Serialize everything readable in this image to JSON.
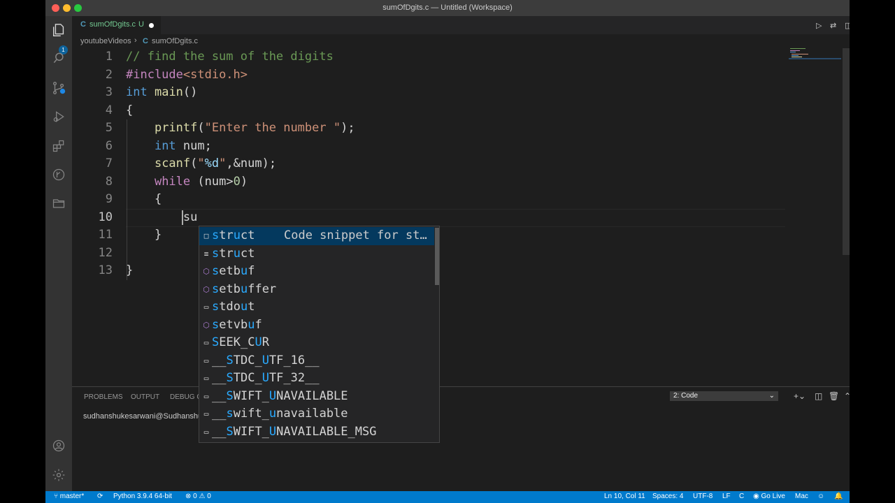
{
  "window": {
    "title": "sumOfDgits.c — Untitled (Workspace)"
  },
  "activity_bar": {
    "explorer_badge": "1"
  },
  "tab": {
    "icon": "C",
    "filename": "sumOfDgits.c",
    "status": "U"
  },
  "breadcrumb": {
    "folder": "youtubeVideos",
    "sep": "›",
    "file_icon": "C",
    "file": "sumOfDgits.c"
  },
  "editor": {
    "lines": [
      {
        "n": "1",
        "text": "// find the sum of the digits"
      },
      {
        "n": "2",
        "text": "#include<stdio.h>"
      },
      {
        "n": "3",
        "text": "int main()"
      },
      {
        "n": "4",
        "text": "{"
      },
      {
        "n": "5",
        "text": "    printf(\"Enter the number \");"
      },
      {
        "n": "6",
        "text": "    int num;"
      },
      {
        "n": "7",
        "text": "    scanf(\"%d\",&num);"
      },
      {
        "n": "8",
        "text": "    while (num>0)"
      },
      {
        "n": "9",
        "text": "    {"
      },
      {
        "n": "10",
        "text": "        su"
      },
      {
        "n": "11",
        "text": "    }"
      },
      {
        "n": "12",
        "text": ""
      },
      {
        "n": "13",
        "text": "}"
      }
    ]
  },
  "suggestions": [
    {
      "label": "struct",
      "kind": "snippet",
      "detail": "Code snippet for st…"
    },
    {
      "label": "struct",
      "kind": "keyword"
    },
    {
      "label": "setbuf",
      "kind": "function"
    },
    {
      "label": "setbuffer",
      "kind": "function"
    },
    {
      "label": "stdout",
      "kind": "variable"
    },
    {
      "label": "setvbuf",
      "kind": "function"
    },
    {
      "label": "SEEK_CUR",
      "kind": "variable"
    },
    {
      "label": "__STDC_UTF_16__",
      "kind": "variable"
    },
    {
      "label": "__STDC_UTF_32__",
      "kind": "variable"
    },
    {
      "label": "__SWIFT_UNAVAILABLE",
      "kind": "variable"
    },
    {
      "label": "__swift_unavailable",
      "kind": "variable"
    },
    {
      "label": "__SWIFT_UNAVAILABLE_MSG",
      "kind": "variable"
    }
  ],
  "panel": {
    "tabs": [
      "PROBLEMS",
      "OUTPUT",
      "DEBUG CO"
    ],
    "terminal_select": "2: Code",
    "terminal_text": "sudhanshukesarwani@Sudhanshus-"
  },
  "statusbar": {
    "branch": "master*",
    "python": "Python 3.9.4 64-bit",
    "errors": "0",
    "warnings": "0",
    "position": "Ln 10, Col 11",
    "spaces": "Spaces: 4",
    "encoding": "UTF-8",
    "eol": "LF",
    "language": "C",
    "golive": "Go Live",
    "platform": "Mac"
  },
  "colors": {
    "keyword": "#569cd6",
    "control": "#c586c0",
    "string": "#ce9178",
    "comment": "#6a9955",
    "function": "#dcdcaa",
    "number": "#b5cea8",
    "variable": "#9cdcfe",
    "accent": "#007acc"
  }
}
